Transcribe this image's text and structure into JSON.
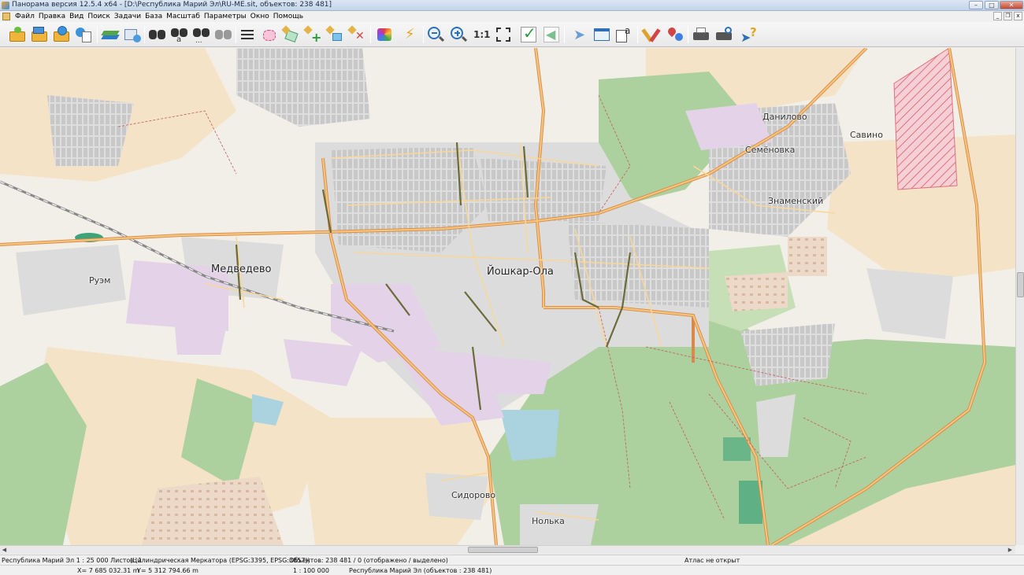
{
  "window": {
    "title": "Панорама версия 12.5.4 x64 - [D:\\Республика Марий Эл\\RU-ME.sit, объектов: 238 481]",
    "controls": {
      "minimize": "–",
      "maximize": "□",
      "close": "✕",
      "mdi_min": "_",
      "mdi_restore": "❐",
      "mdi_close": "x"
    }
  },
  "menu": {
    "items": [
      "Файл",
      "Правка",
      "Вид",
      "Поиск",
      "Задачи",
      "База",
      "Масштаб",
      "Параметры",
      "Окно",
      "Помощь"
    ]
  },
  "toolbar": {
    "scale_1_1": "1:1",
    "icons": [
      "open-folder-icon",
      "open-folder-map-icon",
      "open-globe-icon",
      "open-catalog-icon",
      "layers-icon",
      "layers-settings-icon",
      "binoculars-icon",
      "binoculars-text-icon",
      "binoculars-more-icon",
      "binoculars-gray-icon",
      "list-icon",
      "select-area-icon",
      "select-polygon-icon",
      "add-object-icon",
      "edit-object-icon",
      "delete-object-icon",
      "palette-icon",
      "lightning-icon",
      "zoom-out-icon",
      "zoom-in-icon",
      "fit-frame-icon",
      "check-icon",
      "back-arrow-icon",
      "pointer-icon",
      "window-select-icon",
      "form-icon",
      "pen-brush-icon",
      "route-icon",
      "print-icon",
      "print-preview-icon",
      "help-pointer-icon"
    ]
  },
  "map": {
    "places": {
      "city": "Йошкар-Ола",
      "medvedevo": "Медведево",
      "ruem": "Руэм",
      "danilovo": "Данилово",
      "semenovka": "Семёновка",
      "savino": "Савино",
      "znamensky": "Знаменский",
      "sidorovo": "Сидорово",
      "nolka": "Нолька"
    },
    "colors": {
      "background": "#f2efe9",
      "farmland": "#f5e3c8",
      "forest": "#add19e",
      "residential": "#dcdcdc",
      "industrial": "#e3d2e8",
      "water": "#aad3df",
      "road_primary": "#e8a45a",
      "road_secondary": "#f4c57a",
      "restricted": "#f2b5bd"
    }
  },
  "status": {
    "region_scale": "Республика Марий Эл  1 : 25 000  Листов: 1",
    "projection": "(Цилиндрическая Меркатора (EPSG:3395, EPSG:3857))",
    "objects": "Объектов: 238 481 / 0 (отображено / выделено)",
    "atlas": "Атлас не открыт",
    "x_coord": "X= 7 685 032.31 m",
    "y_coord": "Y= 5 312 794.66 m",
    "scale2": "1 : 100 000",
    "region_objects": "Республика Марий Эл  (объектов : 238 481)"
  }
}
